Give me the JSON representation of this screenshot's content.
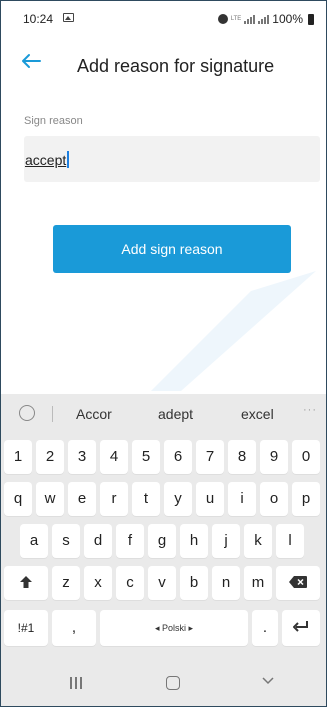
{
  "status_bar": {
    "time": "10:24",
    "battery": "100%",
    "network": "LTE",
    "icons": [
      "image-icon",
      "alarm-icon",
      "signal-icon",
      "signal-icon",
      "battery-icon"
    ]
  },
  "app_bar": {
    "title": "Add reason for signature",
    "back_icon": "arrow-left-icon"
  },
  "form": {
    "field_label": "Sign reason",
    "field_value": "accept",
    "submit_label": "Add sign reason"
  },
  "colors": {
    "accent": "#1a9ad8",
    "back_arrow": "#1a9ad8",
    "cursor": "#1d7fe0"
  },
  "keyboard": {
    "suggestions": [
      "Accor",
      "adept",
      "excel"
    ],
    "more": "···",
    "numbers": [
      "1",
      "2",
      "3",
      "4",
      "5",
      "6",
      "7",
      "8",
      "9",
      "0"
    ],
    "row1": [
      "q",
      "w",
      "e",
      "r",
      "t",
      "y",
      "u",
      "i",
      "o",
      "p"
    ],
    "row2": [
      "a",
      "s",
      "d",
      "f",
      "g",
      "h",
      "j",
      "k",
      "l"
    ],
    "row3": [
      "z",
      "x",
      "c",
      "v",
      "b",
      "n",
      "m"
    ],
    "symbols": "!#1",
    "comma": ",",
    "space": "◂ Polski ▸",
    "period": "."
  },
  "nav_bar": {
    "icons": [
      "recents-icon",
      "home-icon",
      "back-chevron-icon"
    ]
  }
}
